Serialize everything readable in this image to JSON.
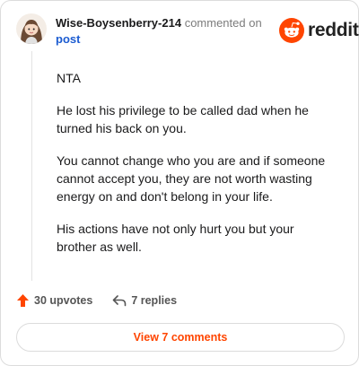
{
  "comment": {
    "username": "Wise-Boysenberry-214",
    "action_text": "commented on",
    "post_link": "post",
    "paragraphs": [
      "NTA",
      "He lost his privilege to be called dad when he turned his back on you.",
      "You cannot change who you are and if someone cannot accept you, they are not worth wasting energy on and don't belong in your life.",
      "His actions have not only hurt you but your brother as well."
    ],
    "upvotes": "30 upvotes",
    "replies": "7 replies"
  },
  "brand": {
    "wordmark": "reddit",
    "accent": "#ff4500"
  },
  "footer": {
    "view_button": "View 7 comments"
  }
}
